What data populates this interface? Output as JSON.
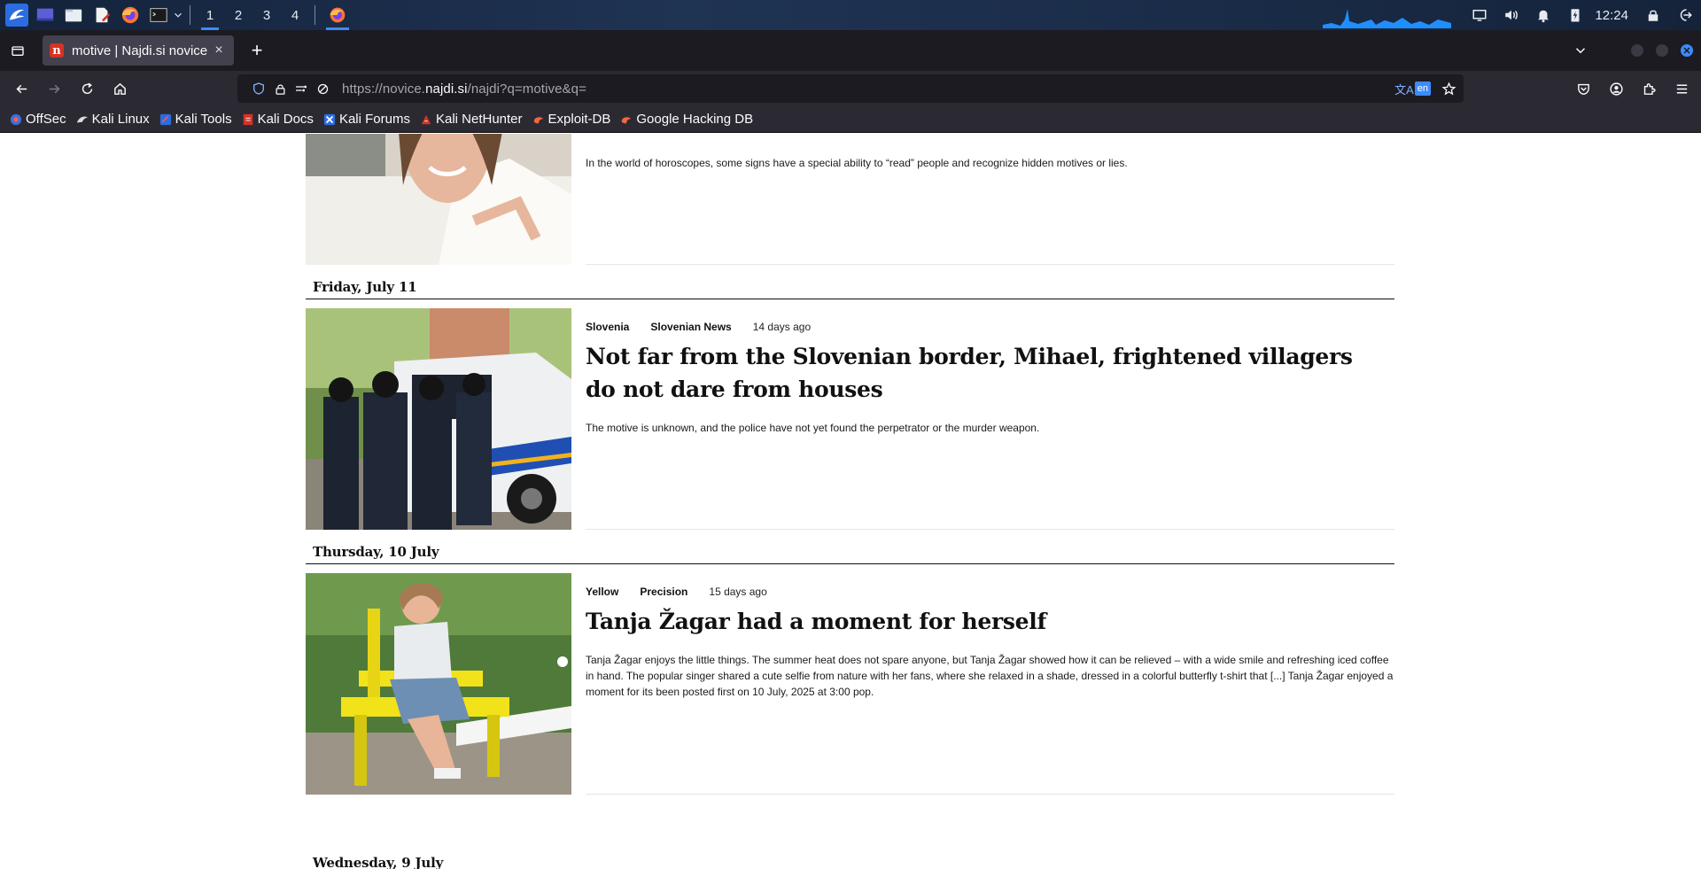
{
  "taskbar": {
    "workspaces": [
      "1",
      "2",
      "3",
      "4"
    ],
    "clock": "12:24"
  },
  "browser": {
    "tab_title": "motive | Najdi.si novice",
    "tab_close": "×",
    "new_tab": "+",
    "url_prefix": "https://novice.",
    "url_domain": "najdi.si",
    "url_path": "/najdi?q=motive&q=",
    "translate_lang": "en",
    "bookmarks": [
      "OffSec",
      "Kali Linux",
      "Kali Tools",
      "Kali Docs",
      "Kali Forums",
      "Kali NetHunter",
      "Exploit-DB",
      "Google Hacking DB"
    ]
  },
  "page": {
    "top_article": {
      "excerpt": "In the world of horoscopes, some signs have a special ability to “read” people and recognize hidden motives or lies."
    },
    "sections": [
      {
        "date": "Friday, July 11",
        "article": {
          "category": "Slovenia",
          "subcategory": "Slovenian News",
          "time": "14 days ago",
          "headline": "Not far from the Slovenian border, Mihael, frightened villagers do not dare from houses",
          "excerpt": "The motive is unknown, and the police have not yet found the perpetrator or the murder weapon."
        }
      },
      {
        "date": "Thursday, 10 July",
        "article": {
          "category": "Yellow",
          "subcategory": "Precision",
          "time": "15 days ago",
          "headline": "Tanja Žagar had a moment for herself",
          "excerpt": "Tanja Žagar enjoys the little things. The summer heat does not spare anyone, but Tanja Žagar showed how it can be relieved – with a wide smile and refreshing iced coffee in hand. The popular singer shared a cute selfie from nature with her fans, where she relaxed in a shade, dressed in a colorful butterfly t-shirt that [...] Tanja Žagar enjoyed a moment for its been posted first on 10 July, 2025 at 3:00 pop."
        }
      },
      {
        "date": "Wednesday, 9 July"
      }
    ]
  }
}
